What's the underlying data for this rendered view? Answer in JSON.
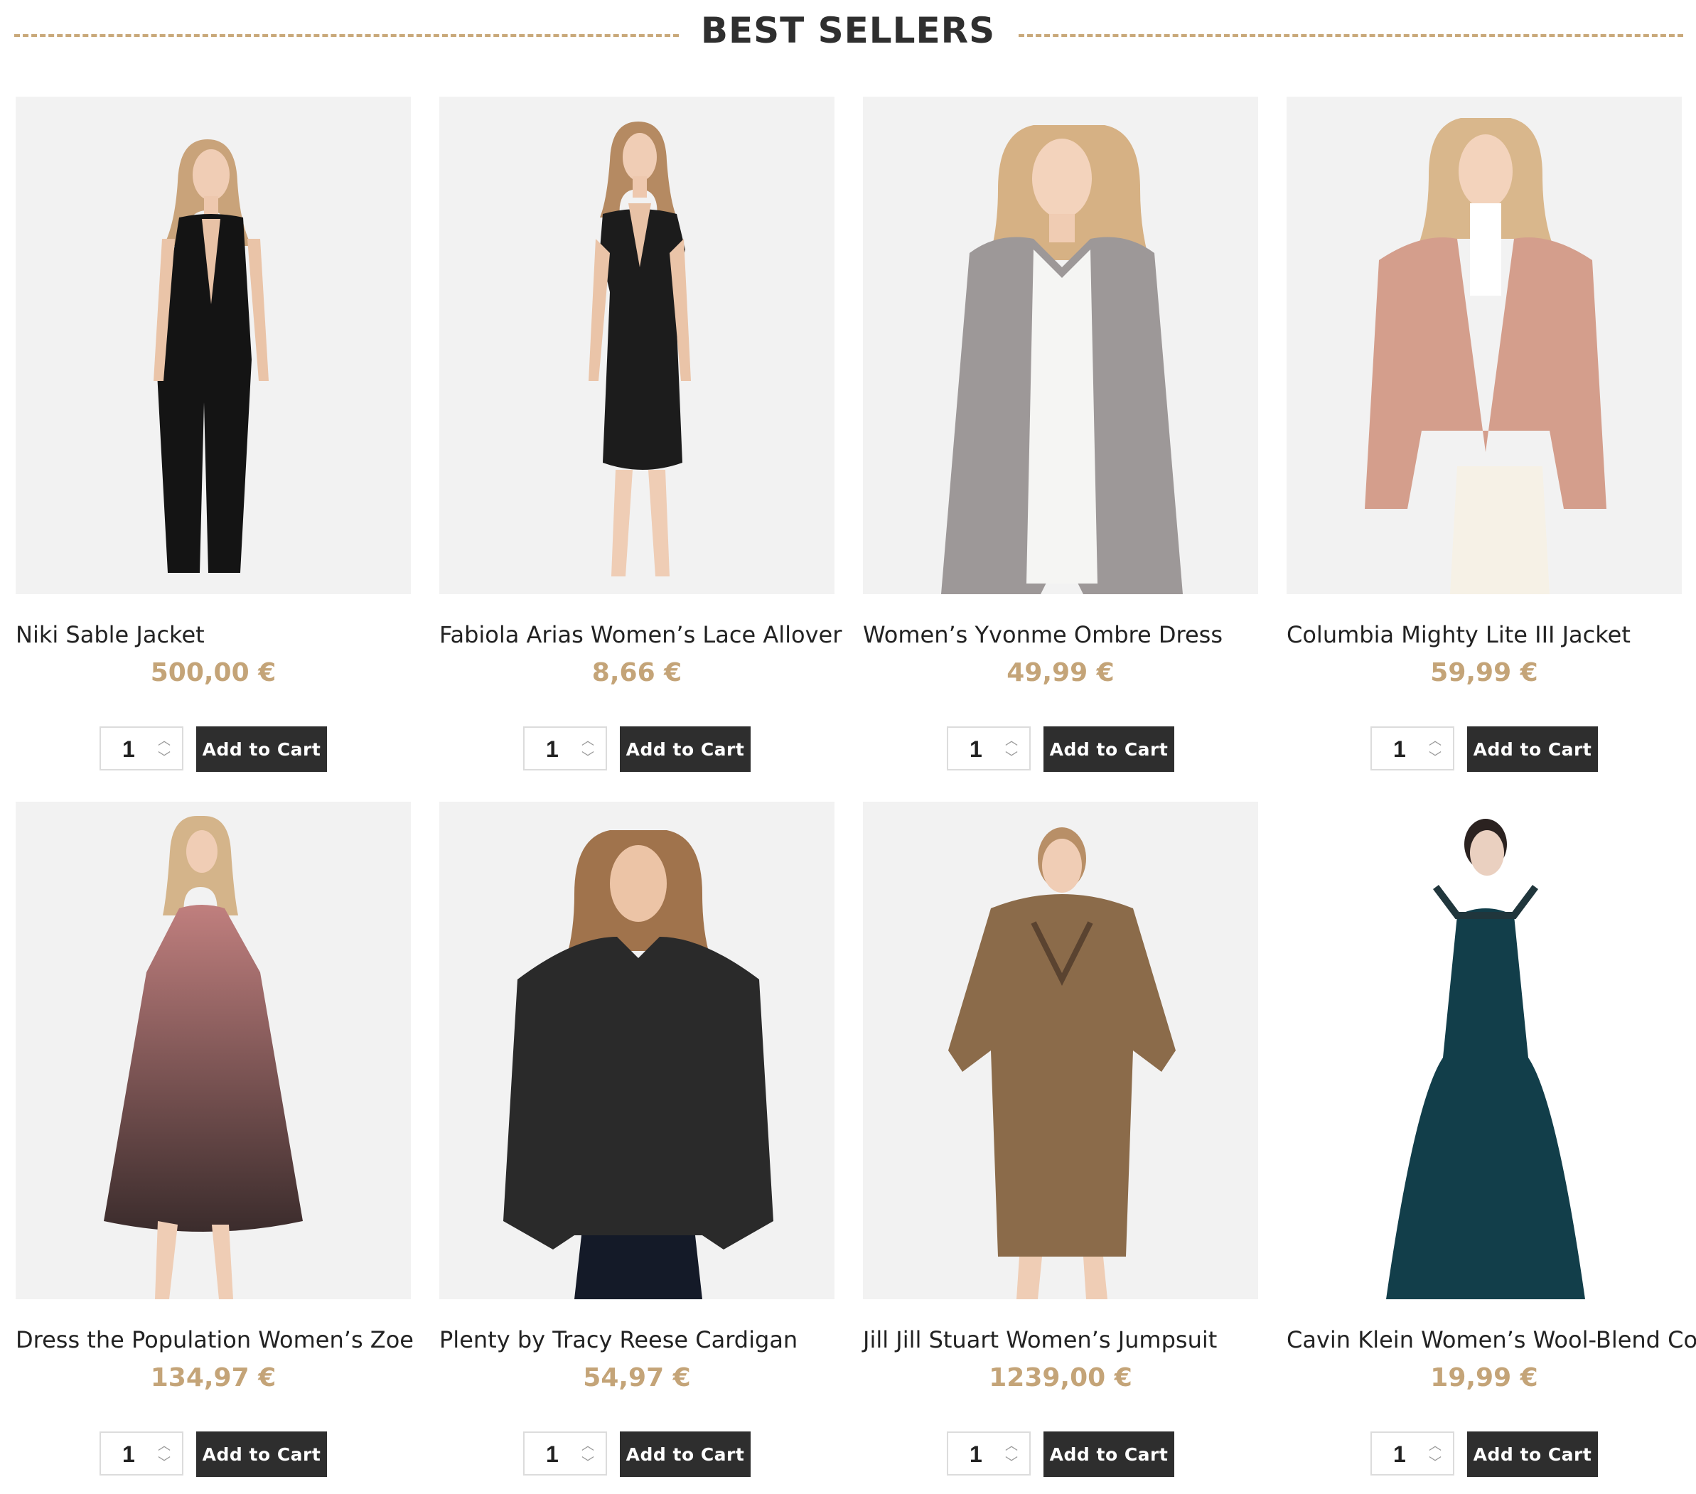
{
  "section": {
    "title": "BEST SELLERS"
  },
  "colors": {
    "accent_price": "#c4a478",
    "button_bg": "#2e2e2e",
    "divider": "#c9a97a",
    "image_bg": "#f2f2f2"
  },
  "products": [
    {
      "name": "Niki Sable Jacket",
      "price": "500,00 €",
      "qty": "1",
      "button": "Add to Cart",
      "image": "woman-black-jumpsuit"
    },
    {
      "name": "Fabiola Arias Women’s Lace Allover",
      "price": "8,66 €",
      "qty": "1",
      "button": "Add to Cart",
      "image": "woman-black-sequin-dress"
    },
    {
      "name": "Women’s Yvonme Ombre Dress",
      "price": "49,99 €",
      "qty": "1",
      "button": "Add to Cart",
      "image": "woman-grey-cardigan"
    },
    {
      "name": "Columbia Mighty Lite III Jacket",
      "price": "59,99 €",
      "qty": "1",
      "button": "Add to Cart",
      "image": "woman-pink-fur-jacket"
    },
    {
      "name": "Dress the Population Women’s Zoe",
      "price": "134,97 €",
      "qty": "1",
      "button": "Add to Cart",
      "image": "woman-ombre-halter-dress"
    },
    {
      "name": "Plenty by Tracy Reese Cardigan",
      "price": "54,97 €",
      "qty": "1",
      "button": "Add to Cart",
      "image": "woman-black-puffer-jacket"
    },
    {
      "name": "Jill Jill Stuart Women’s Jumpsuit",
      "price": "1239,00 €",
      "qty": "1",
      "button": "Add to Cart",
      "image": "woman-brown-fur-coat"
    },
    {
      "name": "Cavin Klein Women’s Wool-Blend Coat",
      "price": "19,99 €",
      "qty": "1",
      "button": "Add to Cart",
      "image": "woman-teal-ball-gown"
    }
  ]
}
